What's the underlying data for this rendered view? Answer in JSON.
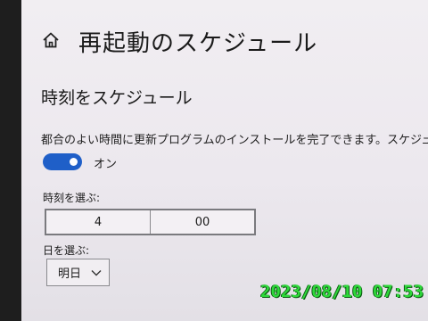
{
  "page": {
    "title": "再起動のスケジュール",
    "home_icon": "home-icon"
  },
  "schedule": {
    "section_title": "時刻をスケジュール",
    "description": "都合のよい時間に更新プログラムのインストールを完了できます。スケジュール",
    "toggle_state": "on",
    "toggle_label": "オン",
    "toggle_color": "#1f5fc8"
  },
  "time_picker": {
    "label": "時刻を選ぶ:",
    "hour": "4",
    "minute": "00"
  },
  "date_picker": {
    "label": "日を選ぶ:",
    "selected": "明日",
    "icon": "chevron-down-icon"
  },
  "camera_stamp": {
    "text": "2023/08/10 07:53",
    "color": "#2ed93a"
  }
}
